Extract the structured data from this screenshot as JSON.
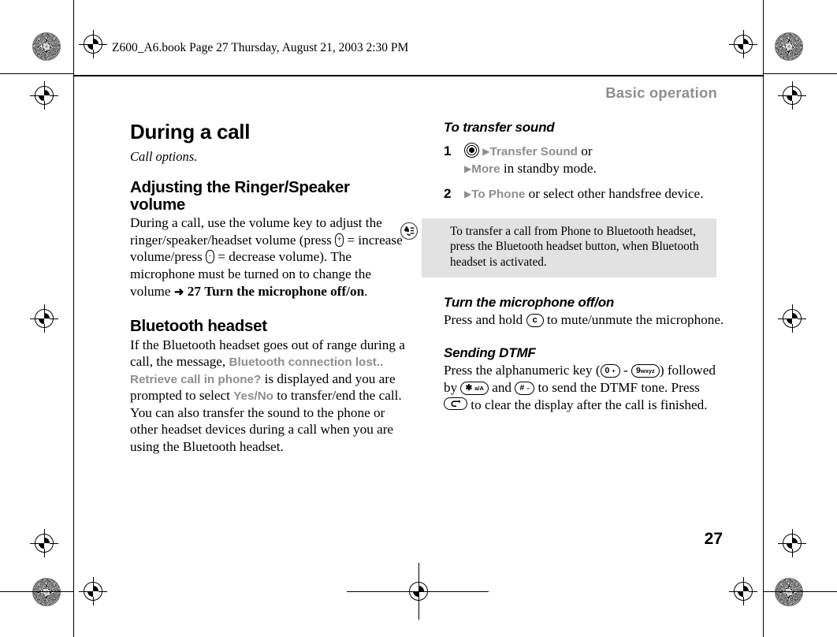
{
  "page": {
    "file_header": "Z600_A6.book  Page 27  Thursday, August 21, 2003  2:30 PM",
    "running_head": "Basic operation",
    "page_number": "27",
    "gray_ui_color": "#8e8e8e",
    "tip_background": "#e2e2e2"
  },
  "left_column": {
    "heading": "During a call",
    "caption": "Call options.",
    "section1": {
      "heading_line1": "Adjusting the Ringer/Speaker",
      "heading_line2": "volume",
      "body_a": "During a call, use the volume key to adjust the ringer/speaker/headset volume (press",
      "body_b": "= increase volume/press",
      "body_c": "= decrease volume). The microphone must be turned on to change the volume",
      "ref_arrow": "➜",
      "ref_page": "27",
      "ref_title": "Turn the microphone off/on",
      "ref_period": ".",
      "key_up": "volume-up-key",
      "key_down": "volume-down-key"
    },
    "section2": {
      "heading": "Bluetooth headset",
      "body_a": "If the Bluetooth headset goes out of range during a call, the message,",
      "ui_message": "Bluetooth connection lost.. Retrieve call in phone?",
      "body_b": "is displayed and you are prompted to select",
      "ui_yes": "Yes",
      "ui_slash": "/",
      "ui_no": "No",
      "body_c": "to transfer/end the call.",
      "body_d": "You can also transfer the sound to the phone or other headset devices during a call when you are using the Bluetooth headset."
    }
  },
  "right_column": {
    "procedure": {
      "heading": "To transfer sound",
      "steps": [
        {
          "number": "1",
          "icon": "joystick-press-icon",
          "arrow": "▶",
          "ui_1": "Transfer Sound",
          "mid": "or",
          "arrow2": "▶",
          "ui_2": "More",
          "tail": "in standby mode."
        },
        {
          "number": "2",
          "arrow": "▶",
          "ui_1": "To Phone",
          "tail": "or select other handsfree device."
        }
      ]
    },
    "tip": {
      "icon": "tip-icon",
      "text": "To transfer a call from Phone to Bluetooth headset, press the Bluetooth headset button, when Bluetooth headset is activated."
    },
    "section_mic": {
      "heading": "Turn the microphone off/on",
      "body_a": "Press and hold",
      "key_label": "c",
      "body_b": "to mute/unmute the microphone."
    },
    "section_dtmf": {
      "heading": "Sending DTMF",
      "body_a": "Press the alphanumeric key (",
      "key_0": "0",
      "key_0_sub": "+",
      "dash": "-",
      "key_9": "9",
      "key_9_sub": "wxyz",
      "body_b": ") followed by",
      "key_star": "✱",
      "key_star_sub": "a/A",
      "body_c": "and",
      "key_hash": "#",
      "key_hash_sub": "–",
      "body_d": "to send the DTMF tone. Press",
      "key_back": "back-key",
      "body_e": "to clear the display after the call is finished."
    }
  }
}
